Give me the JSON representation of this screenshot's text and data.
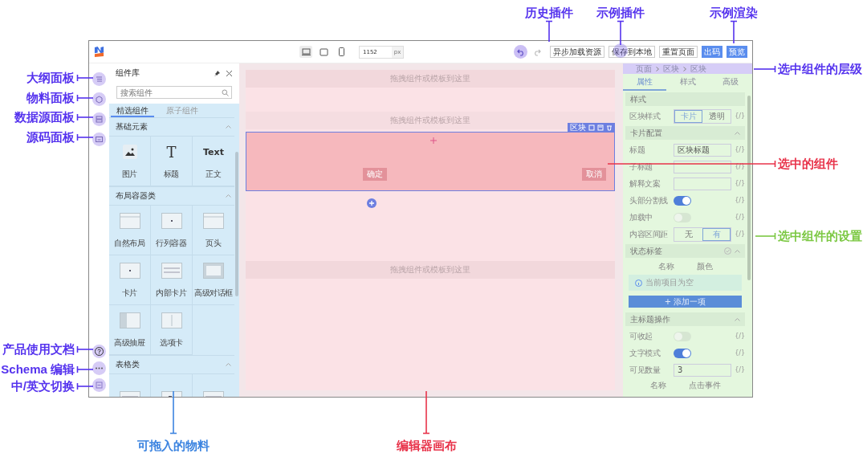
{
  "toolbar": {
    "devices": [
      {
        "kind": "desktop",
        "selected": true
      },
      {
        "kind": "tablet",
        "selected": false
      },
      {
        "kind": "phone",
        "selected": false
      }
    ],
    "width_value": "1152",
    "width_unit": "px",
    "buttons": [
      {
        "label": "异步加载资源",
        "kind": "plain"
      },
      {
        "label": "保存到本地",
        "kind": "plain"
      },
      {
        "label": "重置页面",
        "kind": "plain"
      },
      {
        "label": "出码",
        "kind": "primary"
      },
      {
        "label": "预览",
        "kind": "primary"
      }
    ]
  },
  "component_panel": {
    "title": "组件库",
    "search": {
      "placeholder": "搜索组件"
    },
    "tabs": [
      {
        "label": "精选组件",
        "selected": true
      },
      {
        "label": "原子组件",
        "selected": false
      }
    ],
    "groups": [
      {
        "title": "基础元素",
        "items": [
          {
            "kind": "image",
            "label": "图片"
          },
          {
            "kind": "glyph",
            "glyph": "T",
            "label": "标题"
          },
          {
            "kind": "glyph",
            "glyph": "Text",
            "label": "正文"
          }
        ]
      },
      {
        "title": "布局容器类",
        "items": [
          {
            "kind": "layout",
            "label": "自然布局"
          },
          {
            "kind": "row",
            "label": "行列容器"
          },
          {
            "kind": "header",
            "label": "页头"
          },
          {
            "kind": "card",
            "label": "卡片"
          },
          {
            "kind": "inner-card",
            "label": "内部卡片"
          },
          {
            "kind": "dialog",
            "label": "高级对话框"
          },
          {
            "kind": "drawer",
            "label": "高级抽屉"
          },
          {
            "kind": "tabs",
            "label": "选项卡"
          }
        ]
      },
      {
        "title": "表格类",
        "items": [
          {
            "kind": "table"
          },
          {
            "kind": "table-row"
          },
          {
            "kind": "table-search"
          }
        ]
      }
    ]
  },
  "canvas": {
    "placeholders": [
      "拖拽组件或模板到这里",
      "拖拽组件或模板到这里",
      "拖拽组件或模板到这里"
    ],
    "selected_block": {
      "tag": "区块",
      "buttons": [
        "确定",
        "取消"
      ]
    }
  },
  "settings_panel": {
    "breadcrumb": [
      "页面",
      "区块",
      "区块"
    ],
    "tabs": [
      {
        "label": "属性",
        "selected": true
      },
      {
        "label": "样式",
        "selected": false
      },
      {
        "label": "高级",
        "selected": false
      }
    ],
    "rows": [
      {
        "kind": "group",
        "label": "样式"
      },
      {
        "kind": "segment",
        "label": "区块样式",
        "options": [
          {
            "label": "卡片",
            "selected": true
          },
          {
            "label": "透明",
            "selected": false
          }
        ],
        "var": "{/}"
      },
      {
        "kind": "section",
        "label": "卡片配置"
      },
      {
        "kind": "input",
        "label": "标题",
        "value": "区块标题",
        "var": "{/}"
      },
      {
        "kind": "input",
        "label": "子标题",
        "var": "{/}"
      },
      {
        "kind": "input",
        "label": "解释文案",
        "var": "{/}"
      },
      {
        "kind": "switch",
        "label": "头部分割线",
        "on": true,
        "var": "{/}"
      },
      {
        "kind": "switch",
        "label": "加载中",
        "on": false,
        "var": "{/}"
      },
      {
        "kind": "segment",
        "label": "内容区间距",
        "options": [
          {
            "label": "无",
            "selected": false
          },
          {
            "label": "有",
            "selected": true
          }
        ],
        "var": "{/}"
      },
      {
        "kind": "list-section",
        "label": "状态标签"
      },
      {
        "kind": "columns",
        "columns": [
          "名称",
          "颜色"
        ]
      },
      {
        "kind": "empty",
        "text": "当前项目为空"
      },
      {
        "kind": "add",
        "text": "+ 添加一项"
      },
      {
        "kind": "section",
        "label": "主标题操作"
      },
      {
        "kind": "switch",
        "label": "可收起",
        "on": false,
        "var": "{/}"
      },
      {
        "kind": "switch",
        "label": "文字模式",
        "on": true,
        "var": "{/}"
      },
      {
        "kind": "input",
        "label": "可见数量",
        "value": "3",
        "var": "{/}"
      },
      {
        "kind": "columns",
        "columns": [
          "名称",
          "点击事件"
        ]
      }
    ]
  },
  "callouts": [
    {
      "text": "历史插件",
      "color": "#5533ee"
    },
    {
      "text": "示例插件",
      "color": "#5533ee"
    },
    {
      "text": "示例渲染",
      "color": "#5533ee"
    },
    {
      "text": "选中组件的层级",
      "color": "#5533ee"
    },
    {
      "text": "选中的组件",
      "color": "#e8334a"
    },
    {
      "text": "选中组件的设置",
      "color": "#7cc843"
    },
    {
      "text": "大纲面板",
      "color": "#5533ee"
    },
    {
      "text": "物料面板",
      "color": "#5533ee"
    },
    {
      "text": "数据源面板",
      "color": "#5533ee"
    },
    {
      "text": "源码面板",
      "color": "#5533ee"
    },
    {
      "text": "产品使用文档",
      "color": "#5533ee"
    },
    {
      "text": "Schema 编辑",
      "color": "#5533ee"
    },
    {
      "text": "中/英文切换",
      "color": "#5533ee"
    },
    {
      "text": "可拖入的物料",
      "color": "#3c84e0"
    },
    {
      "text": "编辑器画布",
      "color": "#e8334a"
    }
  ]
}
